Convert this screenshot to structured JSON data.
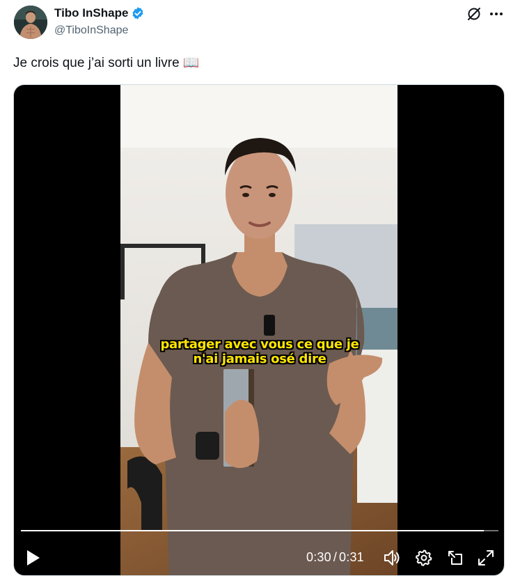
{
  "author": {
    "name": "Tibo InShape",
    "handle": "@TiboInShape",
    "verified": true
  },
  "tweet": {
    "text": "Je crois que j’ai sorti un livre 📖"
  },
  "video": {
    "caption_line1": "partager avec vous ce que je",
    "caption_line2": "n'ai jamais osé dire",
    "current_time": "0:30",
    "separator": "/",
    "duration": "0:31",
    "progress_fraction": 0.97
  },
  "icons": {
    "verified": "verified-badge-icon",
    "grok": "grok-icon",
    "more": "more-horizontal-icon",
    "play": "play-icon",
    "volume": "volume-icon",
    "settings": "gear-icon",
    "dock": "dock-icon",
    "fullscreen": "fullscreen-icon"
  },
  "colors": {
    "verified": "#1d9bf0",
    "text": "#0f1419",
    "secondary": "#536471",
    "caption": "#ffe500"
  }
}
